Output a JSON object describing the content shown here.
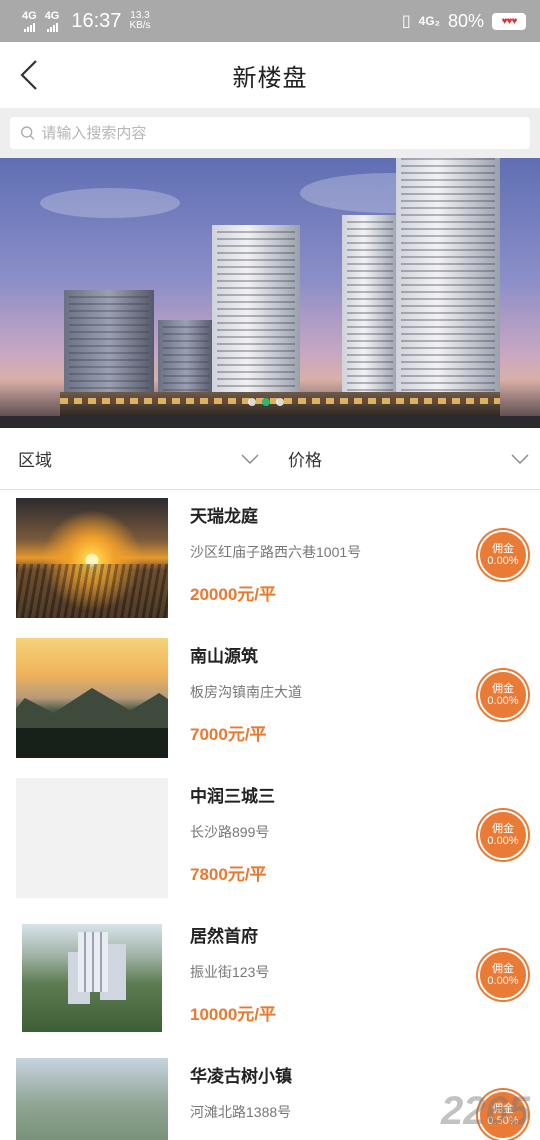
{
  "status_bar": {
    "net1": "4G",
    "net2": "4G",
    "time": "16:37",
    "speed_value": "13.3",
    "speed_unit": "KB/s",
    "net3": "4G₂",
    "battery": "80%"
  },
  "header": {
    "title": "新楼盘"
  },
  "search": {
    "placeholder": "请输入搜索内容"
  },
  "banner": {
    "slide_count": 3,
    "active_slide": 1
  },
  "filters": {
    "area_label": "区域",
    "price_label": "价格"
  },
  "listings": [
    {
      "name": "天瑞龙庭",
      "address": "沙区红庙子路西六巷1001号",
      "price": "20000元/平",
      "badge_line1": "佣金",
      "badge_line2": "0.00%"
    },
    {
      "name": "南山源筑",
      "address": "板房沟镇南庄大道",
      "price": "7000元/平",
      "badge_line1": "佣金",
      "badge_line2": "0.00%"
    },
    {
      "name": "中润三城三",
      "address": "长沙路899号",
      "price": "7800元/平",
      "badge_line1": "佣金",
      "badge_line2": "0.00%"
    },
    {
      "name": "居然首府",
      "address": "振业街123号",
      "price": "10000元/平",
      "badge_line1": "佣金",
      "badge_line2": "0.00%"
    },
    {
      "name": "华凌古树小镇",
      "address": "河滩北路1388号",
      "price": "",
      "badge_line1": "佣金",
      "badge_line2": "0.50%"
    }
  ],
  "watermark": "2265"
}
